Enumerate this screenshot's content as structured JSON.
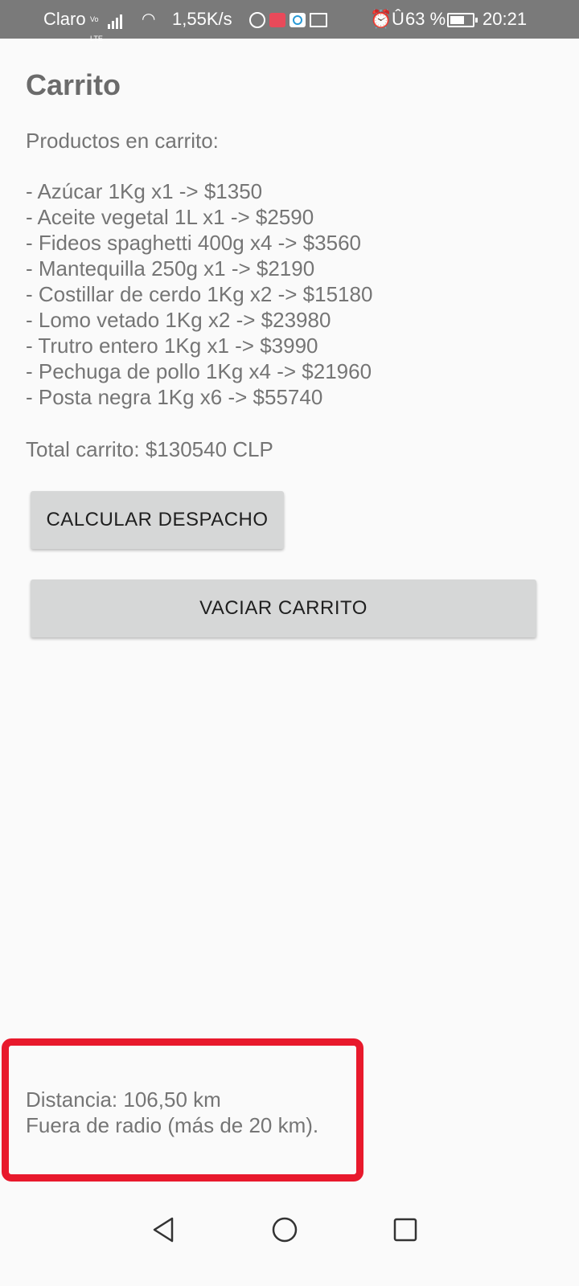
{
  "status_bar": {
    "carrier": "Claro",
    "network_badge": "Vo LTE",
    "network_type": "4G",
    "speed": "1,55K/s",
    "battery": "63 %",
    "time": "20:21",
    "icons": [
      "whatsapp-icon",
      "shopping-bag-icon",
      "q-app-icon",
      "mail-icon",
      "alarm-icon",
      "bluetooth-icon",
      "battery-icon"
    ]
  },
  "page": {
    "title": "Carrito",
    "subtitle": "Productos en carrito:",
    "items": [
      "- Azúcar 1Kg x1 -> $1350",
      "- Aceite vegetal 1L x1 -> $2590",
      "- Fideos spaghetti 400g x4 -> $3560",
      "- Mantequilla 250g x1 -> $2190",
      "- Costillar de cerdo 1Kg x2 -> $15180",
      "- Lomo vetado 1Kg x2 -> $23980",
      "- Trutro entero 1Kg x1 -> $3990",
      "- Pechuga de pollo 1Kg x4 -> $21960",
      "- Posta negra 1Kg x6 -> $55740"
    ],
    "total": "Total carrito: $130540 CLP",
    "buttons": {
      "calculate": "CALCULAR DESPACHO",
      "empty": "VACIAR CARRITO"
    },
    "shipping": {
      "distance": "Distancia: 106,50 km",
      "status": "Fuera de radio (más de 20 km)."
    }
  },
  "colors": {
    "status_bar": "#7a7a7a",
    "background": "#fafafa",
    "button": "#d6d7d7",
    "highlight": "#e8192c",
    "text": "#757575"
  }
}
